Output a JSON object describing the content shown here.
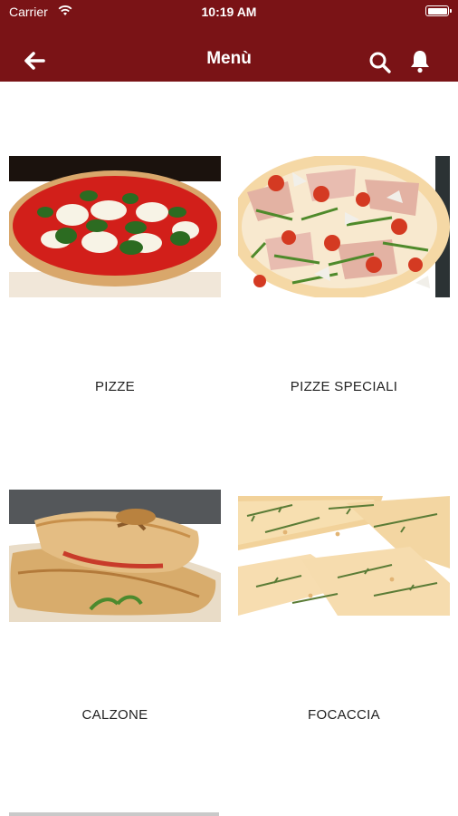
{
  "status_bar": {
    "carrier": "Carrier",
    "time": "10:19 AM"
  },
  "header": {
    "title": "Menù",
    "back_icon": "arrow-left-icon",
    "search_icon": "search-icon",
    "bell_icon": "bell-icon"
  },
  "colors": {
    "header_bg": "#7a1316",
    "text": "#222222"
  },
  "categories": [
    {
      "label": "PIZZE",
      "image": "pizza-margherita-photo"
    },
    {
      "label": "PIZZE SPECIALI",
      "image": "pizza-speciale-photo"
    },
    {
      "label": "CALZONE",
      "image": "calzone-photo"
    },
    {
      "label": "FOCACCIA",
      "image": "focaccia-photo"
    }
  ]
}
